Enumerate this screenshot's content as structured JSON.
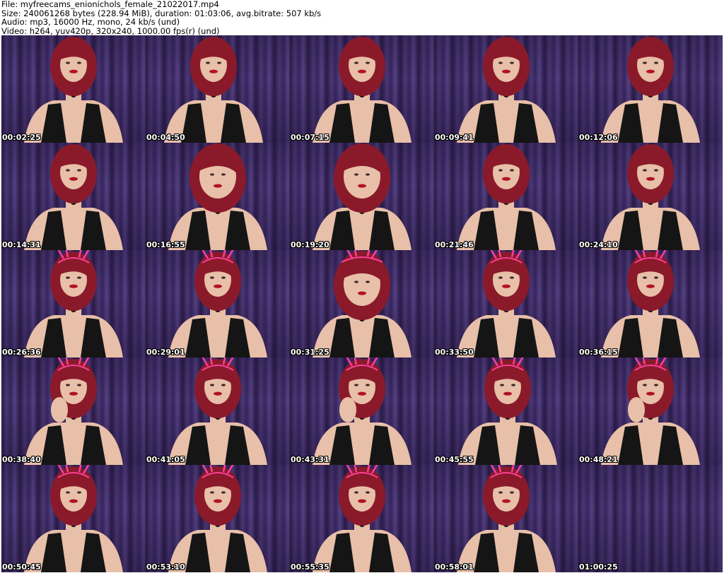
{
  "header": {
    "file_line": "File: myfreecams_enionichols_female_21022017.mp4",
    "size_line": "Size: 240061268 bytes (228.94 MiB), duration: 01:03:06, avg.bitrate: 507 kb/s",
    "audio_line": "Audio: mp3, 16000 Hz, mono, 24 kb/s (und)",
    "video_line": "Video: h264, yuv420p, 320x240, 1000.00 fps(r) (und)"
  },
  "thumbnails": [
    {
      "timestamp": "00:02:25",
      "ears": false,
      "pose": "center"
    },
    {
      "timestamp": "00:04:50",
      "ears": false,
      "pose": "turned"
    },
    {
      "timestamp": "00:07:15",
      "ears": false,
      "pose": "center"
    },
    {
      "timestamp": "00:09:41",
      "ears": false,
      "pose": "center"
    },
    {
      "timestamp": "00:12:06",
      "ears": false,
      "pose": "center"
    },
    {
      "timestamp": "00:14:31",
      "ears": false,
      "pose": "center"
    },
    {
      "timestamp": "00:16:55",
      "ears": false,
      "pose": "close"
    },
    {
      "timestamp": "00:19:20",
      "ears": false,
      "pose": "close"
    },
    {
      "timestamp": "00:21:46",
      "ears": false,
      "pose": "center"
    },
    {
      "timestamp": "00:24:10",
      "ears": false,
      "pose": "center"
    },
    {
      "timestamp": "00:26:36",
      "ears": true,
      "pose": "center"
    },
    {
      "timestamp": "00:29:01",
      "ears": true,
      "pose": "center"
    },
    {
      "timestamp": "00:31:25",
      "ears": true,
      "pose": "close"
    },
    {
      "timestamp": "00:33:50",
      "ears": true,
      "pose": "center"
    },
    {
      "timestamp": "00:36:15",
      "ears": true,
      "pose": "center"
    },
    {
      "timestamp": "00:38:40",
      "ears": true,
      "pose": "hand"
    },
    {
      "timestamp": "00:41:05",
      "ears": true,
      "pose": "center"
    },
    {
      "timestamp": "00:43:31",
      "ears": true,
      "pose": "hand"
    },
    {
      "timestamp": "00:45:55",
      "ears": true,
      "pose": "tilted"
    },
    {
      "timestamp": "00:48:21",
      "ears": true,
      "pose": "hand"
    },
    {
      "timestamp": "00:50:45",
      "ears": true,
      "pose": "center"
    },
    {
      "timestamp": "00:53:10",
      "ears": true,
      "pose": "center"
    },
    {
      "timestamp": "00:55:35",
      "ears": true,
      "pose": "center"
    },
    {
      "timestamp": "00:58:01",
      "ears": true,
      "pose": "center"
    },
    {
      "timestamp": "01:00:25",
      "ears": false,
      "pose": "empty"
    }
  ],
  "colors": {
    "curtain": "#4a3878",
    "hair": "#8a1a2a",
    "skin": "#e8bfa8",
    "outfit": "#151515",
    "ears": "#ff3f9a",
    "timestamp_text": "#ffffff"
  }
}
